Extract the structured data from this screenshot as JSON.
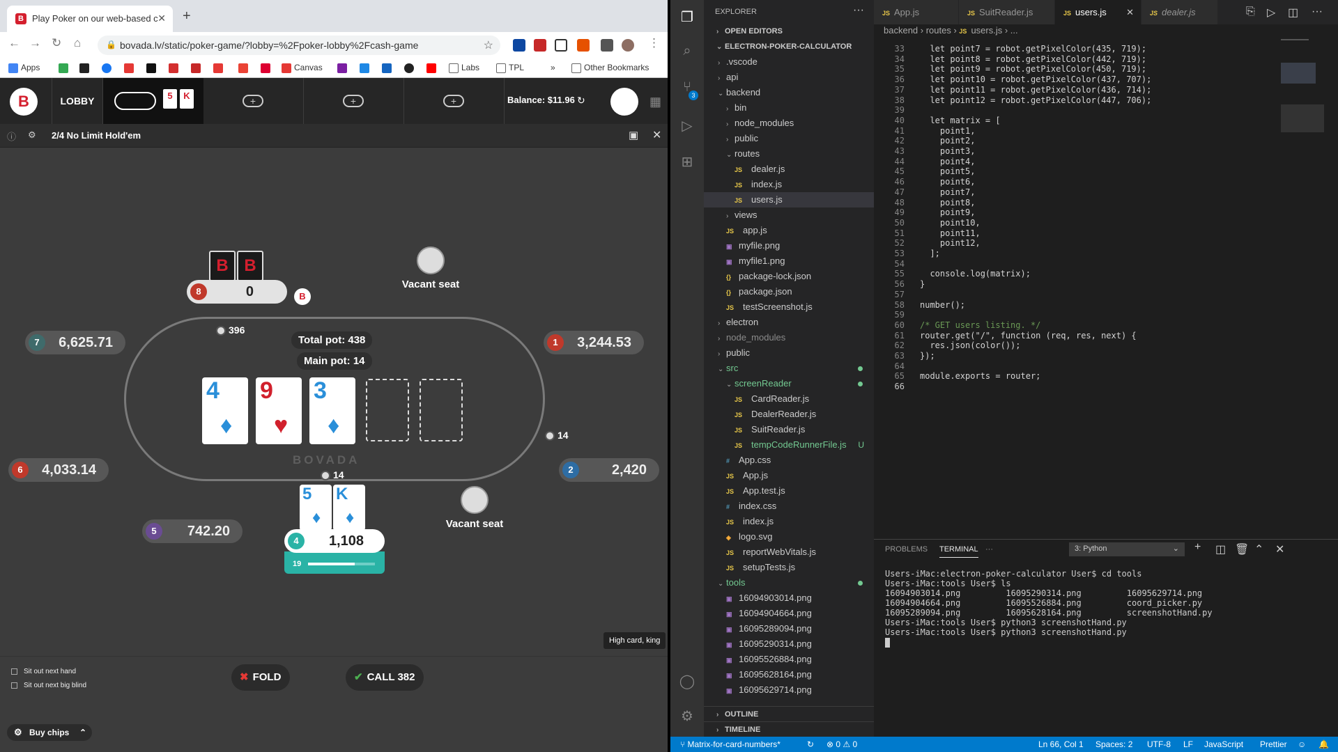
{
  "browser": {
    "tab_title": "Play Poker on our web-based c",
    "url": "bovada.lv/static/poker-game/?lobby=%2Fpoker-lobby%2Fcash-game",
    "bookmarks": [
      "Apps",
      "Canvas",
      "Labs",
      "TPL",
      "Other Bookmarks"
    ],
    "bookmarks_more": "»"
  },
  "poker": {
    "logo": "B",
    "lobby_label": "LOBBY",
    "mini_cards": [
      "5",
      "K"
    ],
    "add_table": "+",
    "balance": "Balance: $11.96",
    "game_name": "2/4 No Limit Hold'em",
    "watermark": "BOVADA",
    "total_pot_label": "Total pot:",
    "total_pot": "438",
    "main_pot_label": "Main pot:",
    "main_pot": "14",
    "community": [
      {
        "rank": "4",
        "suit": "♦",
        "color": "#2a8fd9"
      },
      {
        "rank": "9",
        "suit": "♥",
        "color": "#d1202c"
      },
      {
        "rank": "3",
        "suit": "♦",
        "color": "#2a8fd9"
      }
    ],
    "seats": [
      {
        "no": "8",
        "stack": "0",
        "color": "#c0392b"
      },
      {
        "no": "7",
        "stack": "6,625.71",
        "color": "#3f6b6b"
      },
      {
        "no": "1",
        "stack": "3,244.53",
        "color": "#c0392b"
      },
      {
        "no": "6",
        "stack": "4,033.14",
        "color": "#c0392b"
      },
      {
        "no": "2",
        "stack": "2,420",
        "color": "#2e6da4"
      },
      {
        "no": "5",
        "stack": "742.20",
        "color": "#6a4c93"
      },
      {
        "no": "4",
        "stack": "1,108",
        "color": "#2ab3a6"
      }
    ],
    "bets": {
      "seat7": "396",
      "seat1": "14",
      "seat4": "14"
    },
    "vacant": "Vacant seat",
    "facedown": "B",
    "hero_cards": [
      {
        "rank": "5",
        "suit": "♦"
      },
      {
        "rank": "K",
        "suit": "♦"
      }
    ],
    "timer": "19",
    "timer_fill": 0.7,
    "hand_rank": "High card, king",
    "sit_out_hand": "Sit out next hand",
    "sit_out_blind": "Sit out next big blind",
    "fold": "FOLD",
    "call": "CALL 382",
    "buy_chips": "Buy chips"
  },
  "vscode": {
    "explorer_title": "EXPLORER",
    "open_editors": "OPEN EDITORS",
    "project": "ELECTRON-POKER-CALCULATOR",
    "outline": "OUTLINE",
    "timeline": "TIMELINE",
    "scm_badge": "3",
    "tabs": [
      "App.js",
      "SuitReader.js",
      "users.js",
      "dealer.js"
    ],
    "breadcrumb": [
      "backend",
      "routes",
      "users.js",
      "..."
    ],
    "tree": [
      {
        "n": ".vscode",
        "d": 1,
        "t": "folder"
      },
      {
        "n": "api",
        "d": 1,
        "t": "folder"
      },
      {
        "n": "backend",
        "d": 1,
        "t": "open"
      },
      {
        "n": "bin",
        "d": 2,
        "t": "folder"
      },
      {
        "n": "node_modules",
        "d": 2,
        "t": "folder"
      },
      {
        "n": "public",
        "d": 2,
        "t": "folder"
      },
      {
        "n": "routes",
        "d": 2,
        "t": "open"
      },
      {
        "n": "dealer.js",
        "d": 3,
        "t": "js"
      },
      {
        "n": "index.js",
        "d": 3,
        "t": "js"
      },
      {
        "n": "users.js",
        "d": 3,
        "t": "js",
        "sel": true
      },
      {
        "n": "views",
        "d": 2,
        "t": "folder"
      },
      {
        "n": "app.js",
        "d": 2,
        "t": "js"
      },
      {
        "n": "myfile.png",
        "d": 2,
        "t": "img"
      },
      {
        "n": "myfile1.png",
        "d": 2,
        "t": "img"
      },
      {
        "n": "package-lock.json",
        "d": 2,
        "t": "json"
      },
      {
        "n": "package.json",
        "d": 2,
        "t": "json"
      },
      {
        "n": "testScreenshot.js",
        "d": 2,
        "t": "js"
      },
      {
        "n": "electron",
        "d": 1,
        "t": "folder"
      },
      {
        "n": "node_modules",
        "d": 1,
        "t": "folder",
        "dim": true
      },
      {
        "n": "public",
        "d": 1,
        "t": "folder"
      },
      {
        "n": "src",
        "d": 1,
        "t": "open",
        "green": true,
        "dot": true
      },
      {
        "n": "screenReader",
        "d": 2,
        "t": "open",
        "green": true,
        "dot": true
      },
      {
        "n": "CardReader.js",
        "d": 3,
        "t": "js"
      },
      {
        "n": "DealerReader.js",
        "d": 3,
        "t": "js"
      },
      {
        "n": "SuitReader.js",
        "d": 3,
        "t": "js"
      },
      {
        "n": "tempCodeRunnerFile.js",
        "d": 3,
        "t": "js",
        "green": true,
        "u": "U"
      },
      {
        "n": "App.css",
        "d": 2,
        "t": "css"
      },
      {
        "n": "App.js",
        "d": 2,
        "t": "js"
      },
      {
        "n": "App.test.js",
        "d": 2,
        "t": "js"
      },
      {
        "n": "index.css",
        "d": 2,
        "t": "css"
      },
      {
        "n": "index.js",
        "d": 2,
        "t": "js"
      },
      {
        "n": "logo.svg",
        "d": 2,
        "t": "svg"
      },
      {
        "n": "reportWebVitals.js",
        "d": 2,
        "t": "js"
      },
      {
        "n": "setupTests.js",
        "d": 2,
        "t": "js"
      },
      {
        "n": "tools",
        "d": 1,
        "t": "open",
        "green": true,
        "dot": true
      },
      {
        "n": "16094903014.png",
        "d": 2,
        "t": "img"
      },
      {
        "n": "16094904664.png",
        "d": 2,
        "t": "img"
      },
      {
        "n": "16095289094.png",
        "d": 2,
        "t": "img"
      },
      {
        "n": "16095290314.png",
        "d": 2,
        "t": "img"
      },
      {
        "n": "16095526884.png",
        "d": 2,
        "t": "img"
      },
      {
        "n": "16095628164.png",
        "d": 2,
        "t": "img"
      },
      {
        "n": "16095629714.png",
        "d": 2,
        "t": "img"
      }
    ],
    "code": [
      {
        "l": "33",
        "t": "  let point7 = robot.getPixelColor(435, 719);"
      },
      {
        "l": "34",
        "t": "  let point8 = robot.getPixelColor(442, 719);"
      },
      {
        "l": "35",
        "t": "  let point9 = robot.getPixelColor(450, 719);"
      },
      {
        "l": "36",
        "t": "  let point10 = robot.getPixelColor(437, 707);"
      },
      {
        "l": "37",
        "t": "  let point11 = robot.getPixelColor(436, 714);"
      },
      {
        "l": "38",
        "t": "  let point12 = robot.getPixelColor(447, 706);"
      },
      {
        "l": "39",
        "t": ""
      },
      {
        "l": "40",
        "t": "  let matrix = ["
      },
      {
        "l": "41",
        "t": "    point1,"
      },
      {
        "l": "42",
        "t": "    point2,"
      },
      {
        "l": "43",
        "t": "    point3,"
      },
      {
        "l": "44",
        "t": "    point4,"
      },
      {
        "l": "45",
        "t": "    point5,"
      },
      {
        "l": "46",
        "t": "    point6,"
      },
      {
        "l": "47",
        "t": "    point7,"
      },
      {
        "l": "48",
        "t": "    point8,"
      },
      {
        "l": "49",
        "t": "    point9,"
      },
      {
        "l": "50",
        "t": "    point10,"
      },
      {
        "l": "51",
        "t": "    point11,"
      },
      {
        "l": "52",
        "t": "    point12,"
      },
      {
        "l": "53",
        "t": "  ];"
      },
      {
        "l": "54",
        "t": ""
      },
      {
        "l": "55",
        "t": "  console.log(matrix);"
      },
      {
        "l": "56",
        "t": "}"
      },
      {
        "l": "57",
        "t": ""
      },
      {
        "l": "58",
        "t": "number();"
      },
      {
        "l": "59",
        "t": ""
      },
      {
        "l": "60",
        "t": "/* GET users listing. */"
      },
      {
        "l": "61",
        "t": "router.get(\"/\", function (req, res, next) {"
      },
      {
        "l": "62",
        "t": "  res.json(color());"
      },
      {
        "l": "63",
        "t": "});"
      },
      {
        "l": "64",
        "t": ""
      },
      {
        "l": "65",
        "t": "module.exports = router;"
      },
      {
        "l": "66",
        "t": ""
      }
    ],
    "panel_tabs": [
      "PROBLEMS",
      "TERMINAL",
      "···"
    ],
    "terminal_select": "3: Python",
    "terminal": "Users-iMac:electron-poker-calculator User$ cd tools\nUsers-iMac:tools User$ ls\n16094903014.png         16095290314.png         16095629714.png\n16094904664.png         16095526884.png         coord_picker.py\n16095289094.png         16095628164.png         screenshotHand.py\nUsers-iMac:tools User$ python3 screenshotHand.py\nUsers-iMac:tools User$ python3 screenshotHand.py",
    "status": {
      "branch": "Matrix-for-card-numbers*",
      "problems": "⊗ 0 ⚠ 0",
      "position": "Ln 66, Col 1",
      "spaces": "Spaces: 2",
      "encoding": "UTF-8",
      "eol": "LF",
      "language": "JavaScript",
      "formatter": "Prettier"
    }
  }
}
